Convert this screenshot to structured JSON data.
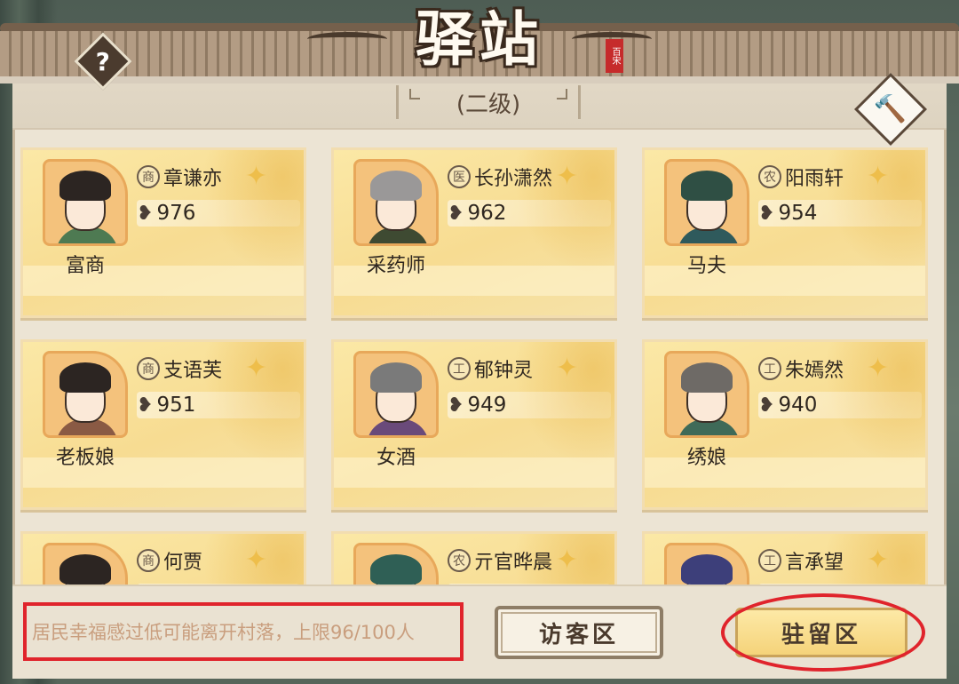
{
  "header": {
    "title": "驿站",
    "seal": "百宋",
    "level": "(二级)"
  },
  "buttons": {
    "help_icon": "?",
    "build_icon": "hammer-icon"
  },
  "residents": [
    {
      "badge": "商",
      "name": "章谦亦",
      "score": "976",
      "role": "富商"
    },
    {
      "badge": "医",
      "name": "长孙潇然",
      "score": "962",
      "role": "采药师"
    },
    {
      "badge": "农",
      "name": "阳雨轩",
      "score": "954",
      "role": "马夫"
    },
    {
      "badge": "商",
      "name": "支语芙",
      "score": "951",
      "role": "老板娘"
    },
    {
      "badge": "工",
      "name": "郁钟灵",
      "score": "949",
      "role": "女酒"
    },
    {
      "badge": "工",
      "name": "朱嫣然",
      "score": "940",
      "role": "绣娘"
    },
    {
      "badge": "商",
      "name": "何贾",
      "score": "",
      "role": ""
    },
    {
      "badge": "农",
      "name": "亓官晔晨",
      "score": "",
      "role": ""
    },
    {
      "badge": "工",
      "name": "言承望",
      "score": "",
      "role": ""
    }
  ],
  "footer": {
    "hint": "居民幸福感过低可能离开村落，上限96/100人",
    "visitor_label": "访客区",
    "stay_label": "驻留区"
  },
  "colors": {
    "highlight": "#e0242c",
    "card": "#f7dc92"
  }
}
